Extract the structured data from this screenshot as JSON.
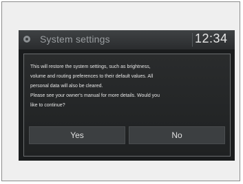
{
  "header": {
    "icon": "gear-icon",
    "title": "System settings",
    "clock": "12:34"
  },
  "dialog": {
    "message_lines": [
      "This will restore the system settings, such as brightness,",
      "volume and routing preferences to their default values. All",
      "personal data will also be cleared.",
      "Please see your owner's manual for more details. Would you",
      "like to continue?"
    ],
    "yes_label": "Yes",
    "no_label": "No"
  },
  "colors": {
    "screen_bg": "#1a1c1d",
    "header_bg": "#3f4244",
    "dialog_border": "#6c6f71",
    "button_bg": "#3c3f41",
    "text": "#e6e6e6"
  }
}
